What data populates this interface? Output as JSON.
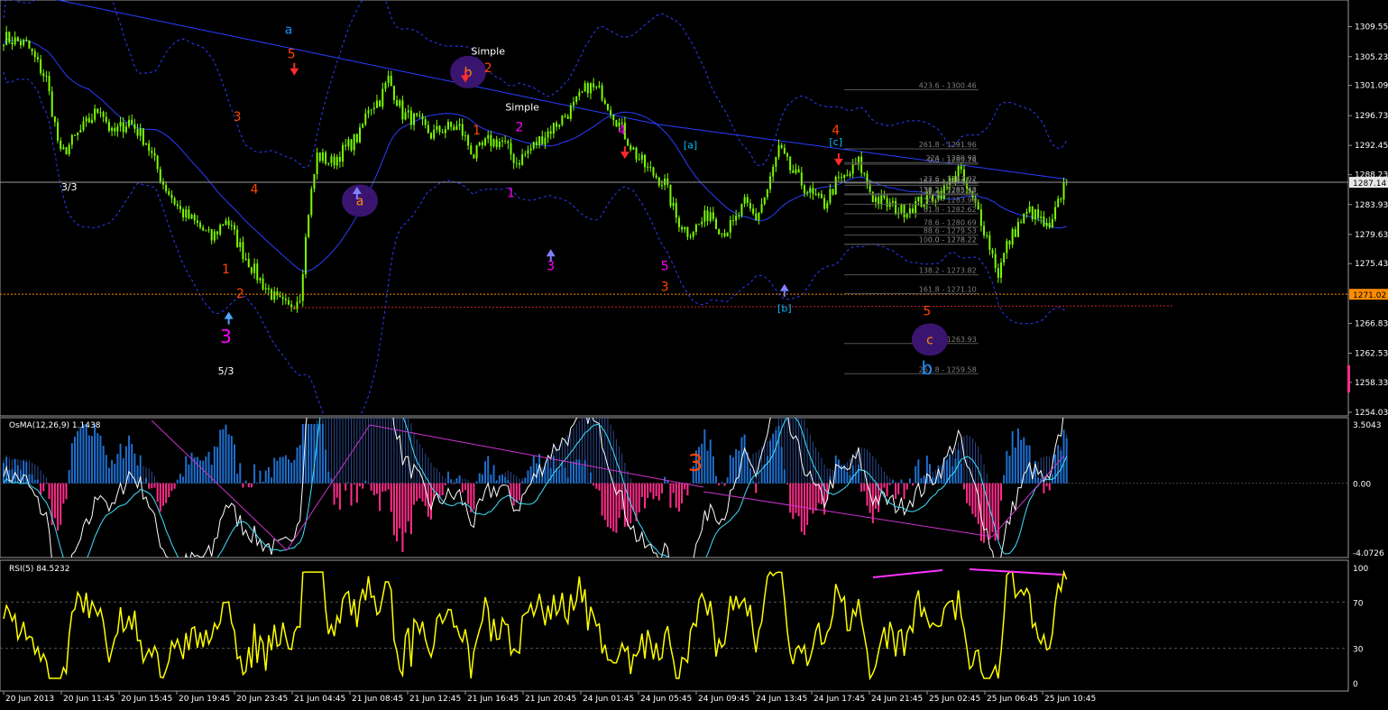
{
  "chart_data": {
    "type": "line",
    "instrument_style": "candlestick",
    "main": {
      "price_ticks": [
        "1309.55",
        "1305.23",
        "1301.09",
        "1296.73",
        "1292.45",
        "1288.23",
        "1283.93",
        "1279.63",
        "1275.43",
        "1271.02",
        "1266.83",
        "1262.53",
        "1258.33",
        "1254.03"
      ],
      "current_price": "1287.14",
      "level_price": "1271.02",
      "ylim": [
        1253.5,
        1312.0
      ],
      "close_path": [
        [
          0,
          1308
        ],
        [
          8,
          1307
        ],
        [
          15,
          1302
        ],
        [
          20,
          1291
        ],
        [
          24,
          1293
        ],
        [
          30,
          1296
        ],
        [
          34,
          1298
        ],
        [
          38,
          1294
        ],
        [
          44,
          1296
        ],
        [
          50,
          1293
        ],
        [
          56,
          1287
        ],
        [
          62,
          1283
        ],
        [
          68,
          1281
        ],
        [
          73,
          1279
        ],
        [
          78,
          1282
        ],
        [
          84,
          1277
        ],
        [
          90,
          1273
        ],
        [
          96,
          1270
        ],
        [
          100,
          1269
        ],
        [
          104,
          1271
        ],
        [
          107,
          1283
        ],
        [
          110,
          1291
        ],
        [
          115,
          1290
        ],
        [
          120,
          1292
        ],
        [
          125,
          1294
        ],
        [
          128,
          1298
        ],
        [
          132,
          1299
        ],
        [
          135,
          1302
        ],
        [
          140,
          1297
        ],
        [
          145,
          1296
        ],
        [
          150,
          1294
        ],
        [
          155,
          1295
        ],
        [
          160,
          1295
        ],
        [
          165,
          1291
        ],
        [
          170,
          1293
        ],
        [
          175,
          1293
        ],
        [
          180,
          1290
        ],
        [
          185,
          1292
        ],
        [
          190,
          1294
        ],
        [
          195,
          1296
        ],
        [
          200,
          1298
        ],
        [
          205,
          1301
        ],
        [
          210,
          1300
        ],
        [
          214,
          1297
        ],
        [
          218,
          1294
        ],
        [
          222,
          1291
        ],
        [
          226,
          1289
        ],
        [
          232,
          1287
        ],
        [
          236,
          1282
        ],
        [
          240,
          1280
        ],
        [
          244,
          1281
        ],
        [
          248,
          1283
        ],
        [
          252,
          1280
        ],
        [
          256,
          1281
        ],
        [
          260,
          1284
        ],
        [
          264,
          1282
        ],
        [
          268,
          1286
        ],
        [
          272,
          1292
        ],
        [
          276,
          1289
        ],
        [
          280,
          1287
        ],
        [
          284,
          1285
        ],
        [
          288,
          1284
        ],
        [
          292,
          1287
        ],
        [
          296,
          1288
        ],
        [
          300,
          1290
        ],
        [
          305,
          1285
        ],
        [
          310,
          1284
        ],
        [
          315,
          1283
        ],
        [
          320,
          1284
        ],
        [
          325,
          1285
        ],
        [
          330,
          1286
        ],
        [
          335,
          1289
        ],
        [
          338,
          1286
        ],
        [
          342,
          1283
        ],
        [
          346,
          1278
        ],
        [
          349,
          1274
        ],
        [
          352,
          1278
        ],
        [
          356,
          1281
        ],
        [
          360,
          1283
        ],
        [
          363,
          1282
        ],
        [
          367,
          1280
        ],
        [
          370,
          1284
        ],
        [
          373,
          1288
        ]
      ],
      "annotations": [
        {
          "text": "a",
          "color": "#1e90ff",
          "t": 100,
          "p": 1308.5,
          "size": "l"
        },
        {
          "text": "5",
          "color": "#ff4500",
          "t": 101,
          "p": 1305,
          "size": "l"
        },
        {
          "text": "3",
          "color": "#ff4500",
          "t": 82,
          "p": 1296.0,
          "size": "l"
        },
        {
          "text": "4",
          "color": "#ff4500",
          "t": 88,
          "p": 1285.5,
          "size": "l"
        },
        {
          "text": "1",
          "color": "#ff4500",
          "t": 78,
          "p": 1274,
          "size": "l"
        },
        {
          "text": "2",
          "color": "#ff4500",
          "t": 83,
          "p": 1270.5,
          "size": "l"
        },
        {
          "text": "3",
          "color": "#ff00ff",
          "t": 78,
          "p": 1264,
          "size": "xl"
        },
        {
          "text": "3/3",
          "color": "#fff",
          "t": 23,
          "p": 1286,
          "size": "m"
        },
        {
          "text": "5/3",
          "color": "#fff",
          "t": 78,
          "p": 1259.5,
          "size": "m"
        },
        {
          "text": "Simple",
          "color": "#fff",
          "t": 170,
          "p": 1305.5,
          "size": "m"
        },
        {
          "text": "2",
          "color": "#ff4500",
          "t": 170,
          "p": 1303,
          "size": "l"
        },
        {
          "text": "1",
          "color": "#ff4500",
          "t": 166,
          "p": 1294,
          "size": "l"
        },
        {
          "text": "Simple",
          "color": "#fff",
          "t": 182,
          "p": 1297.5,
          "size": "m"
        },
        {
          "text": "2",
          "color": "#ff00ff",
          "t": 181,
          "p": 1294.5,
          "size": "l"
        },
        {
          "text": "1",
          "color": "#ff00ff",
          "t": 178,
          "p": 1285,
          "size": "l"
        },
        {
          "text": "3",
          "color": "#ff00ff",
          "t": 192,
          "p": 1274.5,
          "size": "l"
        },
        {
          "text": "4",
          "color": "#ff00ff",
          "t": 217,
          "p": 1294,
          "size": "l"
        },
        {
          "text": "5",
          "color": "#ff00ff",
          "t": 232,
          "p": 1274.5,
          "size": "l"
        },
        {
          "text": "3",
          "color": "#ff4500",
          "t": 232,
          "p": 1271.5,
          "size": "l"
        },
        {
          "text": "[a]",
          "color": "#00bfff",
          "t": 241,
          "p": 1292,
          "size": "m"
        },
        {
          "text": "[b]",
          "color": "#00bfff",
          "t": 274,
          "p": 1268.5,
          "size": "m"
        },
        {
          "text": "[c]",
          "color": "#00bfff",
          "t": 292,
          "p": 1292.5,
          "size": "m"
        },
        {
          "text": "4",
          "color": "#ff4500",
          "t": 292,
          "p": 1294,
          "size": "l"
        },
        {
          "text": "5",
          "color": "#ff4500",
          "t": 324,
          "p": 1268,
          "size": "l"
        },
        {
          "text": "b",
          "color": "#1e90ff",
          "t": 324,
          "p": 1259.5,
          "size": "xl"
        }
      ],
      "circles": [
        {
          "text": "b",
          "t": 163,
          "p": 1303.0,
          "label_color": "#ff8c00"
        },
        {
          "text": "a",
          "t": 125,
          "p": 1284.5,
          "label_color": "#ff8c00"
        },
        {
          "text": "c",
          "t": 325,
          "p": 1264.5,
          "label_color": "#ff8c00"
        }
      ],
      "arrows": [
        {
          "dir": "down",
          "color": "#ff2a2a",
          "t": 102,
          "p": 1302.5
        },
        {
          "dir": "down",
          "color": "#ff2a2a",
          "t": 162,
          "p": 1301.5
        },
        {
          "dir": "down",
          "color": "#ff2a2a",
          "t": 218,
          "p": 1290.5
        },
        {
          "dir": "down",
          "color": "#ff2a2a",
          "t": 293,
          "p": 1289.5
        },
        {
          "dir": "up",
          "color": "#4da6ff",
          "t": 79,
          "p": 1268.5
        },
        {
          "dir": "up",
          "color": "#8080ff",
          "t": 124,
          "p": 1286.5
        },
        {
          "dir": "up",
          "color": "#8080ff",
          "t": 192,
          "p": 1277.5
        },
        {
          "dir": "up",
          "color": "#8080ff",
          "t": 274,
          "p": 1272.5
        }
      ],
      "fibo_levels": [
        {
          "label": "423.6 - 1300.46",
          "p": 1300.46,
          "t0": 295,
          "t1": 342
        },
        {
          "label": "261.8 - 1291.96",
          "p": 1291.96,
          "t0": 295,
          "t1": 342
        },
        {
          "label": "224 - 1289.98",
          "p": 1289.98,
          "t0": 295,
          "t1": 342
        },
        {
          "label": "0.0 - 1289.74",
          "p": 1289.74,
          "t0": 295,
          "t1": 342
        },
        {
          "label": "23.6 - 1287.02",
          "p": 1287.02,
          "t0": 295,
          "t1": 342
        },
        {
          "label": "161.8 - 1286.71",
          "p": 1286.71,
          "t0": 295,
          "t1": 342
        },
        {
          "label": "38.2 - 1285.34",
          "p": 1285.34,
          "t0": 295,
          "t1": 342
        },
        {
          "label": "138.2 - 1285.48",
          "p": 1285.48,
          "t0": 295,
          "t1": 342
        },
        {
          "label": "61.8 - 1282.62",
          "p": 1282.62,
          "t0": 295,
          "t1": 342
        },
        {
          "label": "50.0 - 1283.98",
          "p": 1283.98,
          "t0": 295,
          "t1": 342
        },
        {
          "label": "78.6 - 1280.69",
          "p": 1280.69,
          "t0": 295,
          "t1": 342
        },
        {
          "label": "88.6 - 1279.53",
          "p": 1279.53,
          "t0": 295,
          "t1": 342
        },
        {
          "label": "100.0 - 1278.22",
          "p": 1278.22,
          "t0": 295,
          "t1": 342
        },
        {
          "label": "0.0 - 1278.22",
          "p": 1278.22,
          "t0": 295,
          "t1": 342
        },
        {
          "label": "138.2 - 1273.82",
          "p": 1273.82,
          "t0": 295,
          "t1": 342
        },
        {
          "label": "161.8 - 1271.10",
          "p": 1271.1,
          "t0": 295,
          "t1": 342
        },
        {
          "label": "224 - 1263.93",
          "p": 1263.93,
          "t0": 295,
          "t1": 342
        },
        {
          "label": "261.8 - 1259.58",
          "p": 1259.58,
          "t0": 295,
          "t1": 342
        }
      ]
    },
    "osma": {
      "title": "OsMA(12,26,9) 1.1438",
      "ticks": [
        "3.5043",
        "0.00",
        "-4.0726"
      ],
      "ylim": [
        -4.0726,
        3.5043
      ],
      "label": "3"
    },
    "rsi": {
      "title": "RSI(5) 84.5232",
      "ticks": [
        "100",
        "70",
        "30",
        "0"
      ],
      "ylim": [
        0,
        100
      ]
    },
    "time_labels": [
      "20 Jun 2013",
      "20 Jun 11:45",
      "20 Jun 15:45",
      "20 Jun 19:45",
      "20 Jun 23:45",
      "21 Jun 04:45",
      "21 Jun 08:45",
      "21 Jun 12:45",
      "21 Jun 16:45",
      "21 Jun 20:45",
      "24 Jun 01:45",
      "24 Jun 05:45",
      "24 Jun 09:45",
      "24 Jun 13:45",
      "24 Jun 17:45",
      "24 Jun 21:45",
      "25 Jun 02:45",
      "25 Jun 06:45",
      "25 Jun 10:45"
    ],
    "colors": {
      "background": "#000000",
      "candle": "#7cfc00",
      "ma": "#2a3cff",
      "band": "#2a3cff",
      "osma_pos": "#1e6fd0",
      "osma_neg": "#ff2d8a",
      "rsi": "#ffff00",
      "level": "#ff8c00",
      "circle": "#3a1570"
    }
  }
}
